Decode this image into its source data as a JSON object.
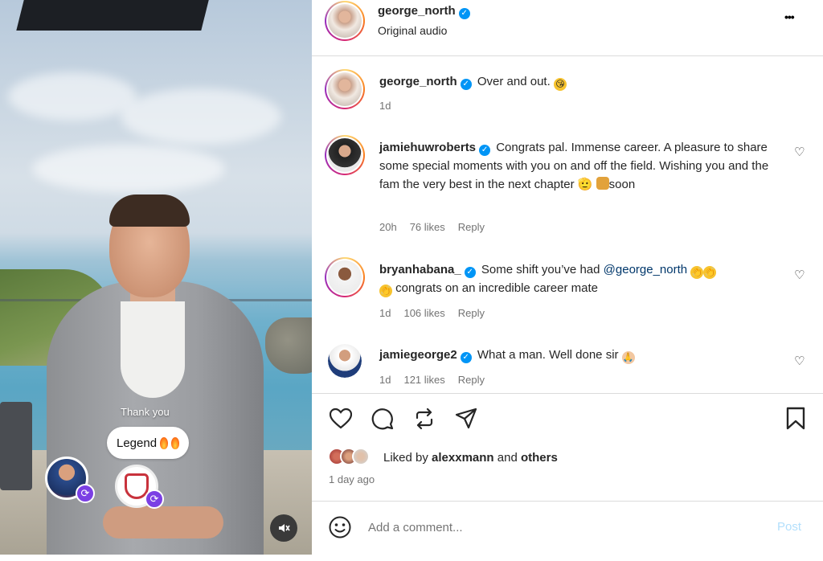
{
  "video": {
    "overlay_text": "Thank you",
    "bubble_text": "Legend",
    "icons": [
      "remix-icon",
      "mute-icon"
    ]
  },
  "header": {
    "username": "george_north",
    "subtitle": "Original audio",
    "more_label": "•••"
  },
  "caption": {
    "username": "george_north",
    "text": "Over and out.",
    "time": "1d"
  },
  "comments": [
    {
      "username": "jamiehuwroberts",
      "text": "Congrats pal. Immense career. A pleasure to share some special moments with you on and off the field. Wishing you and the fam the very best in the next chapter 🫡",
      "text_tail": "soon",
      "time": "20h",
      "likes": "76 likes",
      "reply": "Reply"
    },
    {
      "username": "bryanhabana_",
      "text": "Some shift you’ve had",
      "mention": "@george_north",
      "text_tail": "congrats on an incredible career mate",
      "time": "1d",
      "likes": "106 likes",
      "reply": "Reply"
    },
    {
      "username": "jamiegeorge2",
      "text": "What a man. Well done sir",
      "time": "1d",
      "likes": "121 likes",
      "reply": "Reply"
    }
  ],
  "likes": {
    "prefix": "Liked by",
    "user": "alexxmann",
    "joiner": "and",
    "others": "others",
    "date": "1 day ago"
  },
  "comment_box": {
    "placeholder": "Add a comment...",
    "post_label": "Post"
  },
  "colors": {
    "verified": "#0095f6",
    "link": "#00376b",
    "post_disabled": "#b2dffc",
    "remix": "#7b3fe4"
  }
}
